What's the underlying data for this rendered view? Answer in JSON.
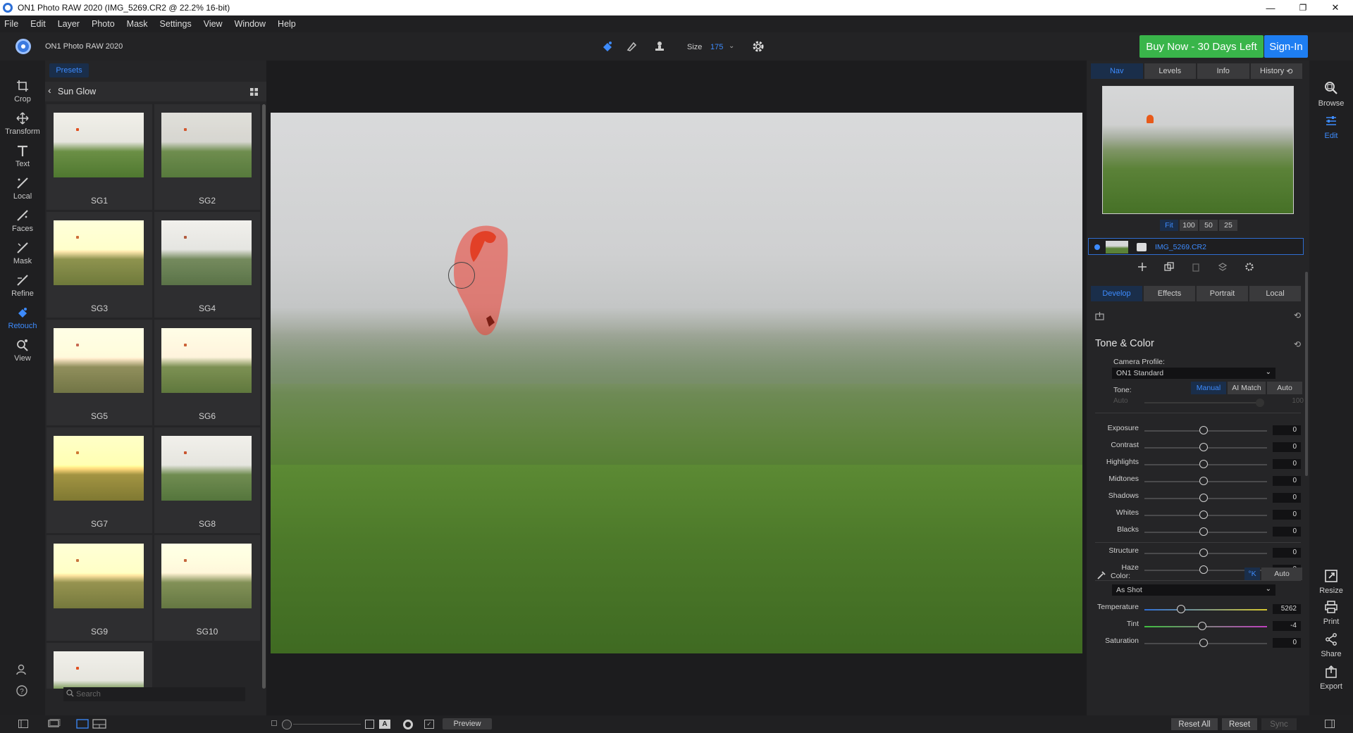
{
  "window": {
    "title": "ON1 Photo RAW 2020 (IMG_5269.CR2 @ 22.2% 16-bit)",
    "minimize": "—",
    "maximize": "❐",
    "close": "✕"
  },
  "menu": [
    "File",
    "Edit",
    "Layer",
    "Photo",
    "Mask",
    "Settings",
    "View",
    "Window",
    "Help"
  ],
  "topbar": {
    "app_name": "ON1 Photo RAW 2020",
    "size_label": "Size",
    "size_value": "175",
    "buy_label": "Buy Now - 30 Days Left",
    "signin_label": "Sign-In"
  },
  "tools": [
    {
      "label": "Crop",
      "icon": "crop-icon"
    },
    {
      "label": "Transform",
      "icon": "transform-icon"
    },
    {
      "label": "Text",
      "icon": "text-icon"
    },
    {
      "label": "Local",
      "icon": "local-brush-icon"
    },
    {
      "label": "Faces",
      "icon": "faces-icon"
    },
    {
      "label": "Mask",
      "icon": "mask-brush-icon"
    },
    {
      "label": "Refine",
      "icon": "refine-brush-icon"
    },
    {
      "label": "Retouch",
      "icon": "retouch-icon",
      "active": true
    },
    {
      "label": "View",
      "icon": "view-zoom-icon"
    }
  ],
  "presets": {
    "tab_label": "Presets",
    "category": "Sun Glow",
    "items": [
      "SG1",
      "SG2",
      "SG3",
      "SG4",
      "SG5",
      "SG6",
      "SG7",
      "SG8",
      "SG9",
      "SG10"
    ],
    "search_placeholder": "Search"
  },
  "right_panel": {
    "tabs": [
      "Nav",
      "Levels",
      "Info",
      "History"
    ],
    "zoom_levels": [
      "Fit",
      "100",
      "50",
      "25"
    ],
    "layer_name": "IMG_5269.CR2",
    "module_tabs": [
      "Develop",
      "Effects",
      "Portrait",
      "Local"
    ],
    "section_title": "Tone & Color",
    "camera_profile_label": "Camera Profile:",
    "camera_profile_value": "ON1 Standard",
    "tone_label": "Tone:",
    "tone_modes": [
      "Manual",
      "AI Match",
      "Auto"
    ],
    "auto_label": "Auto",
    "auto_value": "100",
    "sliders": [
      {
        "label": "Exposure",
        "value": "0"
      },
      {
        "label": "Contrast",
        "value": "0"
      },
      {
        "label": "Highlights",
        "value": "0"
      },
      {
        "label": "Midtones",
        "value": "0"
      },
      {
        "label": "Shadows",
        "value": "0"
      },
      {
        "label": "Whites",
        "value": "0"
      },
      {
        "label": "Blacks",
        "value": "0"
      },
      {
        "label": "Structure",
        "value": "0"
      },
      {
        "label": "Haze",
        "value": "0"
      }
    ],
    "color_label": "Color:",
    "color_k": "°K",
    "color_auto": "Auto",
    "white_balance": "As Shot",
    "color_sliders": [
      {
        "label": "Temperature",
        "value": "5262"
      },
      {
        "label": "Tint",
        "value": "-4"
      },
      {
        "label": "Saturation",
        "value": "0"
      }
    ]
  },
  "right_rail": [
    {
      "label": "Browse",
      "icon": "browse-icon"
    },
    {
      "label": "Edit",
      "icon": "edit-sliders-icon",
      "active": true
    },
    {
      "label": "Resize",
      "icon": "resize-icon"
    },
    {
      "label": "Print",
      "icon": "print-icon"
    },
    {
      "label": "Share",
      "icon": "share-icon"
    },
    {
      "label": "Export",
      "icon": "export-icon"
    }
  ],
  "bottom": {
    "preview_label": "Preview",
    "reset_all_label": "Reset All",
    "reset_label": "Reset",
    "sync_label": "Sync"
  },
  "colors": {
    "accent": "#3d8bfd",
    "buy": "#39b54a",
    "signin": "#1e7ef2",
    "mask_overlay": "#ee3c30"
  }
}
